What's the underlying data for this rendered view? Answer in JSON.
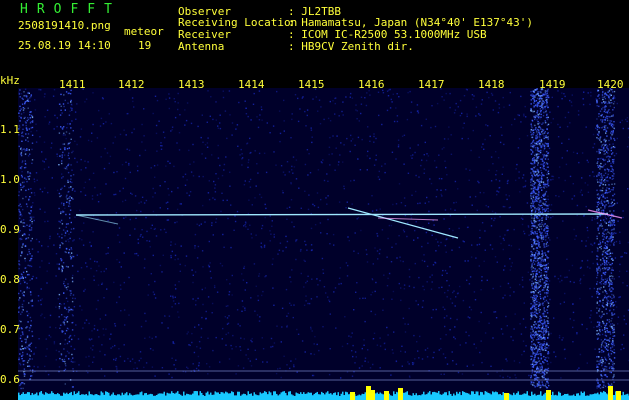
{
  "brand": "HROFFT",
  "file": "2508191410.png",
  "timestamp": "25.08.19 14:10",
  "meteor": {
    "label": "meteor",
    "count": "19"
  },
  "info": {
    "observer_label": "Observer",
    "observer": ": JL2TBB",
    "location_label": "Receiving Location",
    "location": ": Hamamatsu, Japan (N34°40' E137°43')",
    "receiver_label": "Receiver",
    "receiver": ": ICOM IC-R2500 53.1000MHz USB",
    "antenna_label": "Antenna",
    "antenna": ": HB9CV Zenith dir."
  },
  "axis": {
    "y_unit": "kHz",
    "y_ticks": [
      "1.1",
      "1.0",
      "0.9",
      "0.8",
      "0.7",
      "0.6"
    ],
    "x_ticks": [
      "1411",
      "1412",
      "1413",
      "1414",
      "1415",
      "1416",
      "1417",
      "1418",
      "1419",
      "1420"
    ]
  },
  "colors": {
    "label": "#ffff3a",
    "brand": "#33ee33",
    "background": "#00002a",
    "noise": "#1a2cc8",
    "signal": "#9fe8ff",
    "bottom_trace": "#18c8ff",
    "bottom_peaks": "#ffff00"
  }
}
